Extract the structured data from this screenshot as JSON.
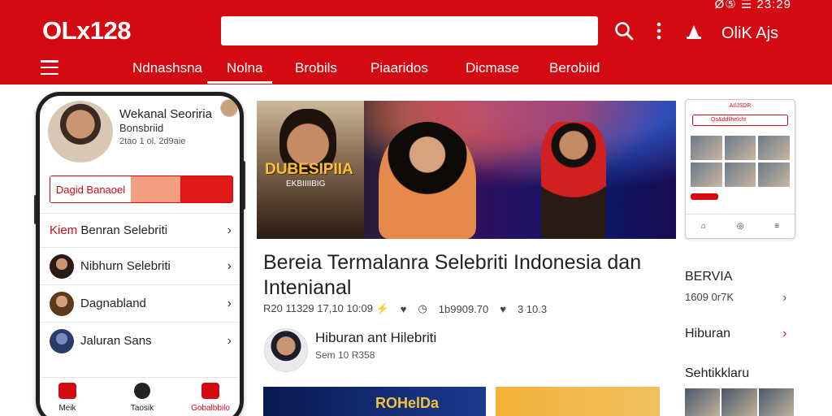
{
  "status_bar": {
    "time": "Ø⑤ ☰ 23:29"
  },
  "header": {
    "logo": "OLx128",
    "user_label": "OliK Ajs",
    "nav": [
      "Ndnashsna",
      "Nolna",
      "Brobils",
      "Piaaridos",
      "Dicmase",
      "Berobiid"
    ]
  },
  "phone": {
    "title": "Wekanal Seoriria",
    "subtitle": "Bonsbriid",
    "meta": "2tao 1 ol. 2d9aie",
    "bar_label": "Dagid Banaoel",
    "list": [
      {
        "prefix": "Kiem",
        "label": "Benran Selebriti"
      },
      {
        "prefix": "",
        "label": "Nibhurn Selebriti"
      },
      {
        "prefix": "",
        "label": "Dagnabland"
      },
      {
        "prefix": "",
        "label": "Jaluran Sans"
      }
    ],
    "tabs": [
      "Meik",
      "Taosik",
      "Gobalbbilo"
    ]
  },
  "hero": {
    "badge": "DUBESIPIIA",
    "badge_sub": "EKBIIIIBIG"
  },
  "article": {
    "title": "Bereia Termalanra Selebriti Indonesia dan Intenianal",
    "meta_left": "R20 11329 17,10 10:09 ⚡",
    "meta_mid": "1b9909.70",
    "meta_right": "3 10.3",
    "author": "Hiburan ant Hilebriti",
    "author_date": "Sem 10 R358",
    "thumb_text": "ROHelDa"
  },
  "mini_screen": {
    "title": "AIIJSDR",
    "search_placeholder": "Qs&ddllhelcht"
  },
  "sidebar": {
    "label1": "BERVIA",
    "label2": "1609 0r7K",
    "label3": "Hiburan",
    "label4": "Sehtikklaru"
  },
  "colors": {
    "brand": "#d40a12",
    "accent_orange": "#f2a080"
  }
}
